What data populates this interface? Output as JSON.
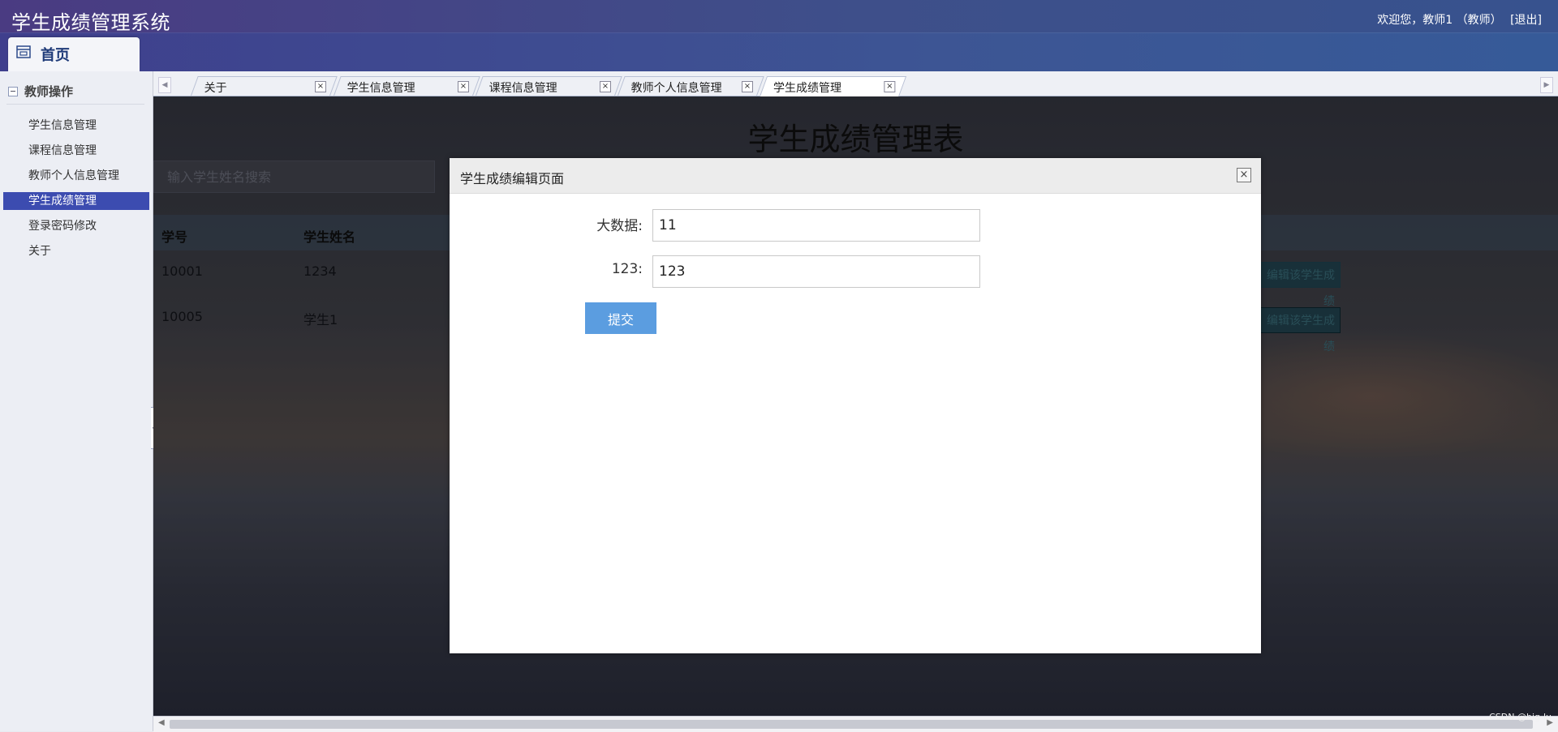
{
  "header": {
    "app_title": "学生成绩管理系统",
    "welcome": "欢迎您，教师1 （教师）",
    "logout": "[退出]",
    "home_tab": "首页"
  },
  "sidebar": {
    "group_title": "教师操作",
    "items": [
      {
        "label": "学生信息管理"
      },
      {
        "label": "课程信息管理"
      },
      {
        "label": "教师个人信息管理"
      },
      {
        "label": "学生成绩管理"
      },
      {
        "label": "登录密码修改"
      },
      {
        "label": "关于"
      }
    ],
    "active_index": 3
  },
  "tabs": [
    {
      "label": "关于"
    },
    {
      "label": "学生信息管理"
    },
    {
      "label": "课程信息管理"
    },
    {
      "label": "教师个人信息管理"
    },
    {
      "label": "学生成绩管理"
    }
  ],
  "main": {
    "title": "学生成绩管理表",
    "search_placeholder": "输入学生姓名搜索",
    "columns": [
      "学号",
      "学生姓名"
    ],
    "rows": [
      {
        "id": "10001",
        "name": "1234",
        "action": "编辑该学生成绩"
      },
      {
        "id": "10005",
        "name": "学生1",
        "action": "编辑该学生成绩"
      }
    ]
  },
  "modal": {
    "title": "学生成绩编辑页面",
    "fields": [
      {
        "label": "大数据:",
        "value": "11"
      },
      {
        "label": "123:",
        "value": "123"
      }
    ],
    "submit_label": "提交"
  },
  "watermark": "CSDN @big-lu",
  "colors": {
    "header": "#3e4f8a",
    "sidebar_active": "#3c4cb0",
    "submit": "#5b9de0"
  }
}
